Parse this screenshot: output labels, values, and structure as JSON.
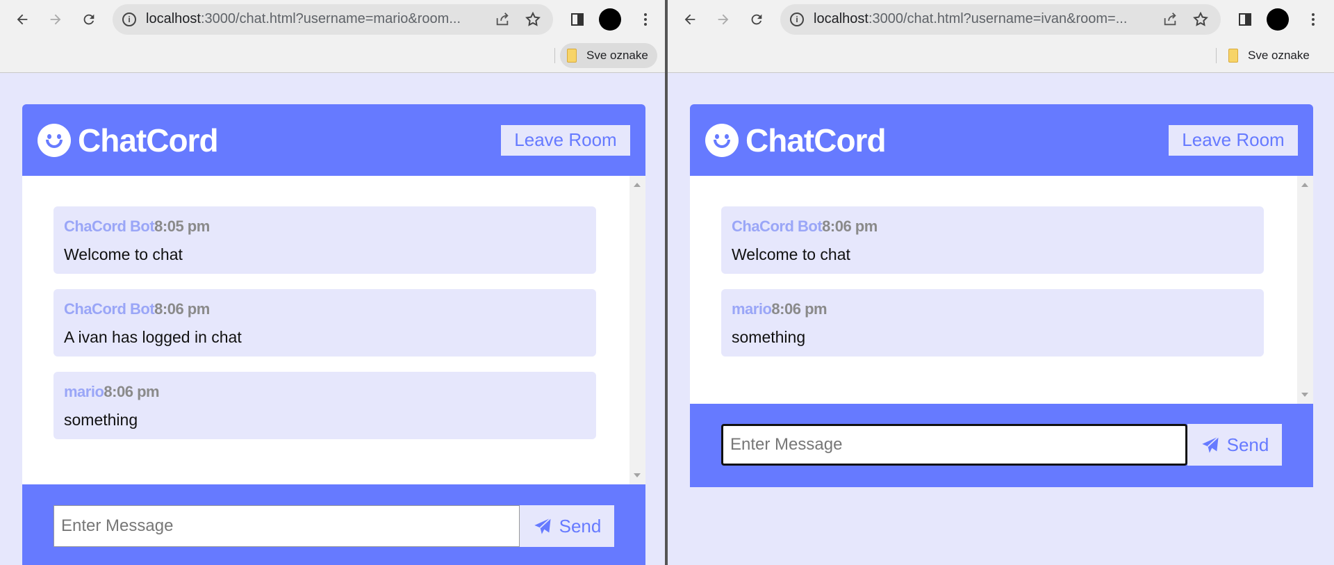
{
  "windows": [
    {
      "url_host": "localhost",
      "url_rest": ":3000/chat.html?username=mario&room...",
      "bookmark_label": "Sve oznake",
      "app_title": "ChatCord",
      "leave_label": "Leave Room",
      "messages": [
        {
          "user": "ChaCord Bot",
          "time": "8:05 pm",
          "text": "Welcome to chat"
        },
        {
          "user": "ChaCord Bot",
          "time": "8:06 pm",
          "text": "A ivan has logged in chat"
        },
        {
          "user": "mario",
          "time": "8:06 pm",
          "text": "something"
        }
      ],
      "input_placeholder": "Enter Message",
      "send_label": "Send"
    },
    {
      "url_host": "localhost",
      "url_rest": ":3000/chat.html?username=ivan&room=...",
      "bookmark_label": "Sve oznake",
      "app_title": "ChatCord",
      "leave_label": "Leave Room",
      "messages": [
        {
          "user": "ChaCord Bot",
          "time": "8:06 pm",
          "text": "Welcome to chat"
        },
        {
          "user": "mario",
          "time": "8:06 pm",
          "text": "something"
        }
      ],
      "input_placeholder": "Enter Message",
      "send_label": "Send"
    }
  ],
  "colors": {
    "primary": "#667aff",
    "light": "#e6e7fc",
    "username": "#9aa6f7"
  }
}
